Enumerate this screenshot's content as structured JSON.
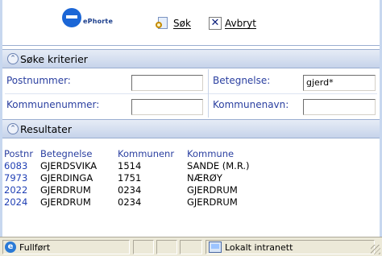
{
  "toolbar": {
    "logo_text": "ePhorte",
    "search_label": "Søk",
    "cancel_label": "Avbryt"
  },
  "search_section": {
    "title": "Søke kriterier",
    "postnummer_label": "Postnummer:",
    "postnummer_value": "",
    "betegnelse_label": "Betegnelse:",
    "betegnelse_value": "gjerd*",
    "kommunenummer_label": "Kommunenummer:",
    "kommunenummer_value": "",
    "kommunenavn_label": "Kommunenavn:",
    "kommunenavn_value": ""
  },
  "results_section": {
    "title": "Resultater",
    "columns": [
      "Postnr",
      "Betegnelse",
      "Kommunenr",
      "Kommune"
    ],
    "rows": [
      [
        "6083",
        "GJERDSVIKA",
        "1514",
        "SANDE (M.R.)"
      ],
      [
        "7973",
        "GJERDINGA",
        "1751",
        "NÆRØY"
      ],
      [
        "2022",
        "GJERDRUM",
        "0234",
        "GJERDRUM"
      ],
      [
        "2024",
        "GJERDRUM",
        "0234",
        "GJERDRUM"
      ]
    ]
  },
  "statusbar": {
    "status_text": "Fullført",
    "zone_text": "Lokalt intranett"
  }
}
